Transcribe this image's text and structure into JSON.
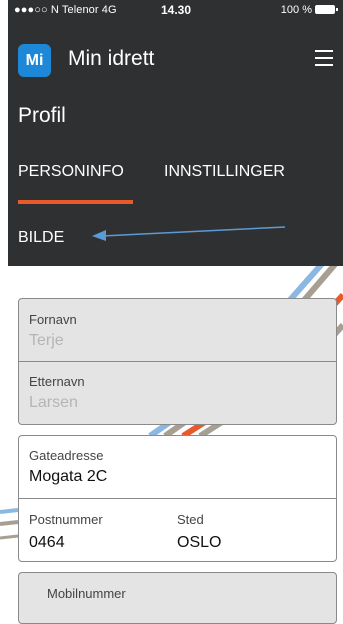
{
  "status_bar": {
    "carrier": "●●●○○ N Telenor  4G",
    "time": "14.30",
    "battery": "100 %"
  },
  "app": {
    "logo_text": "Mi",
    "title": "Min idrett",
    "menu_icon": "hamburger-icon"
  },
  "page": {
    "title": "Profil"
  },
  "tabs": [
    {
      "label": "PERSONINFO",
      "active": true
    },
    {
      "label": "INNSTILLINGER",
      "active": false
    }
  ],
  "bilde_label": "BILDE",
  "colors": {
    "header_bg": "#2f3032",
    "accent": "#e8592b",
    "logo_bg": "#1e88d8",
    "arrow": "#5b9bd5"
  },
  "form": {
    "name_card": {
      "first_name": {
        "label": "Fornavn",
        "value": "Terje"
      },
      "last_name": {
        "label": "Etternavn",
        "value": "Larsen"
      }
    },
    "address_card": {
      "street": {
        "label": "Gateadresse",
        "value": "Mogata 2C"
      },
      "postal": {
        "label": "Postnummer",
        "value": "0464"
      },
      "city": {
        "label": "Sted",
        "value": "OSLO"
      }
    },
    "mobile": {
      "label": "Mobilnummer"
    }
  }
}
